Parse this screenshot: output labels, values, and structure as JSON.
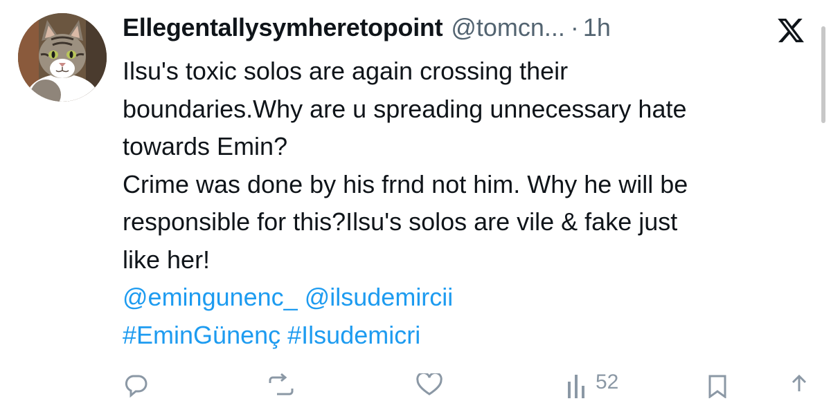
{
  "tweet": {
    "display_name": "Ellegentallysymheretopoint",
    "handle": "@tomcn...",
    "separator": "·",
    "time": "1h",
    "lines": [
      "Ilsu's toxic solos are again crossing their",
      "boundaries.Why are u spreading unnecessary hate",
      "towards Emin?",
      "Crime was done by his frnd not him. Why he will  be",
      "responsible for this?Ilsu's solos are vile & fake just",
      "like her!"
    ],
    "mentions": [
      "@emingunenc_",
      "@ilsudemircii"
    ],
    "hashtags": [
      "#EminGünenç",
      "#Ilsudemicri"
    ]
  },
  "actions": {
    "views_count": "52"
  },
  "icons": {
    "avatar": "cat-avatar-icon",
    "platform_logo": "x-logo-icon",
    "reply": "reply-icon",
    "retweet": "retweet-icon",
    "like": "heart-icon",
    "views": "views-icon",
    "bookmark": "bookmark-icon",
    "share": "share-icon"
  },
  "colors": {
    "text": "#0f1419",
    "muted": "#536471",
    "link": "#1d9bf0",
    "background": "#ffffff"
  }
}
